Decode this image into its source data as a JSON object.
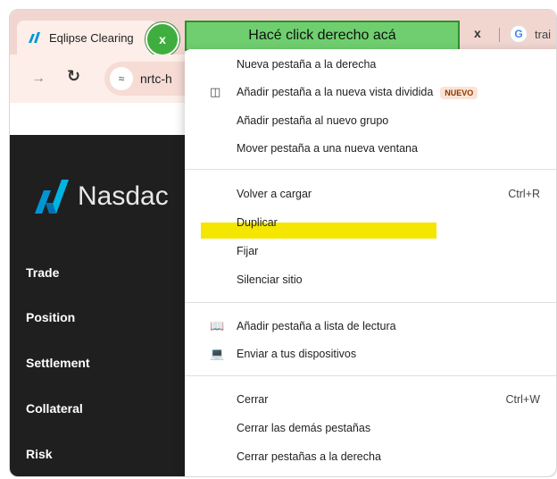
{
  "browser": {
    "active_tab_title": "Eqlipse Clearing",
    "tab_close_label": "x",
    "callout_text": "Hacé click derecho acá",
    "other_tab_close": "x",
    "other_tab_text": "trai",
    "google_letter": "G",
    "url_text": "nrtc-h",
    "site_info_icon": "tune-icon"
  },
  "page": {
    "logo_text": "Nasdac",
    "nav": [
      "Trade",
      "Position",
      "Settlement",
      "Collateral",
      "Risk"
    ]
  },
  "menu": {
    "items": [
      {
        "label": "Nueva pestaña a la derecha"
      },
      {
        "label": "Añadir pestaña a la nueva vista dividida",
        "badge": "NUEVO",
        "icon": "split-view-icon"
      },
      {
        "label": "Añadir pestaña al nuevo grupo"
      },
      {
        "label": "Mover pestaña a una nueva ventana"
      },
      {
        "label": "Volver a cargar",
        "shortcut": "Ctrl+R"
      },
      {
        "label": "Duplicar",
        "highlighted": true
      },
      {
        "label": "Fijar"
      },
      {
        "label": "Silenciar sitio"
      },
      {
        "label": "Añadir pestaña a lista de lectura",
        "icon": "reading-list-icon"
      },
      {
        "label": "Enviar a tus dispositivos",
        "icon": "devices-icon"
      },
      {
        "label": "Cerrar",
        "shortcut": "Ctrl+W"
      },
      {
        "label": "Cerrar las demás pestañas"
      },
      {
        "label": "Cerrar pestañas a la derecha"
      }
    ]
  },
  "colors": {
    "highlight": "#f5e600",
    "callout_bg": "#6fcf6f",
    "callout_border": "#2f8f2f",
    "sidebar_bg": "#1f1f1f",
    "nasdaq_blue": "#0096d6"
  }
}
